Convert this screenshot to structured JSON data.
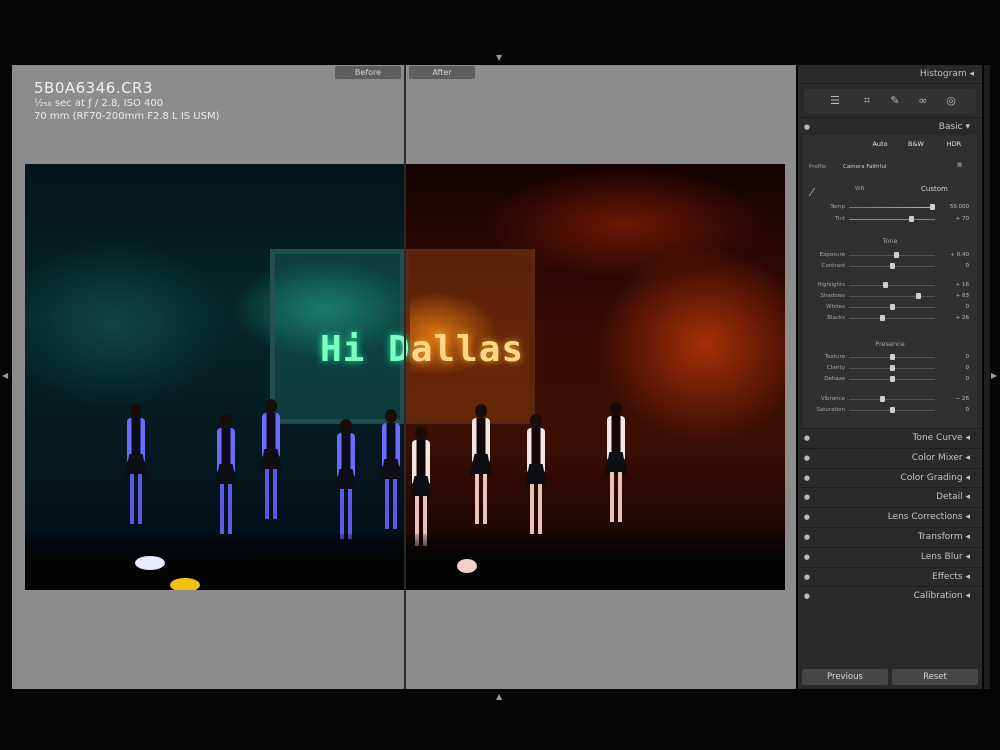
{
  "viewer": {
    "before_label": "Before",
    "after_label": "After",
    "filename": "5B0A6346.CR3",
    "exposure_line": "¹⁄₂₅₀ sec at ƒ / 2.8, ISO 400",
    "lens_line": "70 mm (RF70-200mm F2.8 L IS USM)",
    "photo_text": "Hi Dallas",
    "photo_text_before": "Hi D",
    "photo_text_after": "allas"
  },
  "panel": {
    "histogram_label": "Histogram",
    "basic_label": "Basic",
    "modes": [
      "Auto",
      "B&W",
      "HDR"
    ],
    "profile_label": "Profile",
    "profile_value": "Camera Faithful",
    "wb_label": "WB",
    "wb_value": "Custom",
    "tone_label": "Tone",
    "presence_label": "Presence",
    "sliders_wb": [
      {
        "label": "Temp",
        "value": "50,000",
        "pos": 0.96
      },
      {
        "label": "Tint",
        "value": "+ 70",
        "pos": 0.72
      }
    ],
    "sliders_tone": [
      {
        "label": "Exposure",
        "value": "+ 0.40",
        "pos": 0.55
      },
      {
        "label": "Contrast",
        "value": "0",
        "pos": 0.5
      },
      {
        "label": "Highlights",
        "value": "+ 16",
        "pos": 0.42
      },
      {
        "label": "Shadows",
        "value": "+ 83",
        "pos": 0.8
      },
      {
        "label": "Whites",
        "value": "0",
        "pos": 0.5
      },
      {
        "label": "Blacks",
        "value": "+ 26",
        "pos": 0.38
      }
    ],
    "sliders_presence": [
      {
        "label": "Texture",
        "value": "0",
        "pos": 0.5
      },
      {
        "label": "Clarity",
        "value": "0",
        "pos": 0.5
      },
      {
        "label": "Dehaze",
        "value": "0",
        "pos": 0.5
      },
      {
        "label": "Vibrance",
        "value": "− 26",
        "pos": 0.38
      },
      {
        "label": "Saturation",
        "value": "0",
        "pos": 0.5
      }
    ],
    "sections": [
      "Tone Curve",
      "Color Mixer",
      "Color Grading",
      "Detail",
      "Lens Corrections",
      "Transform",
      "Lens Blur",
      "Effects",
      "Calibration"
    ],
    "previous_label": "Previous",
    "reset_label": "Reset"
  }
}
